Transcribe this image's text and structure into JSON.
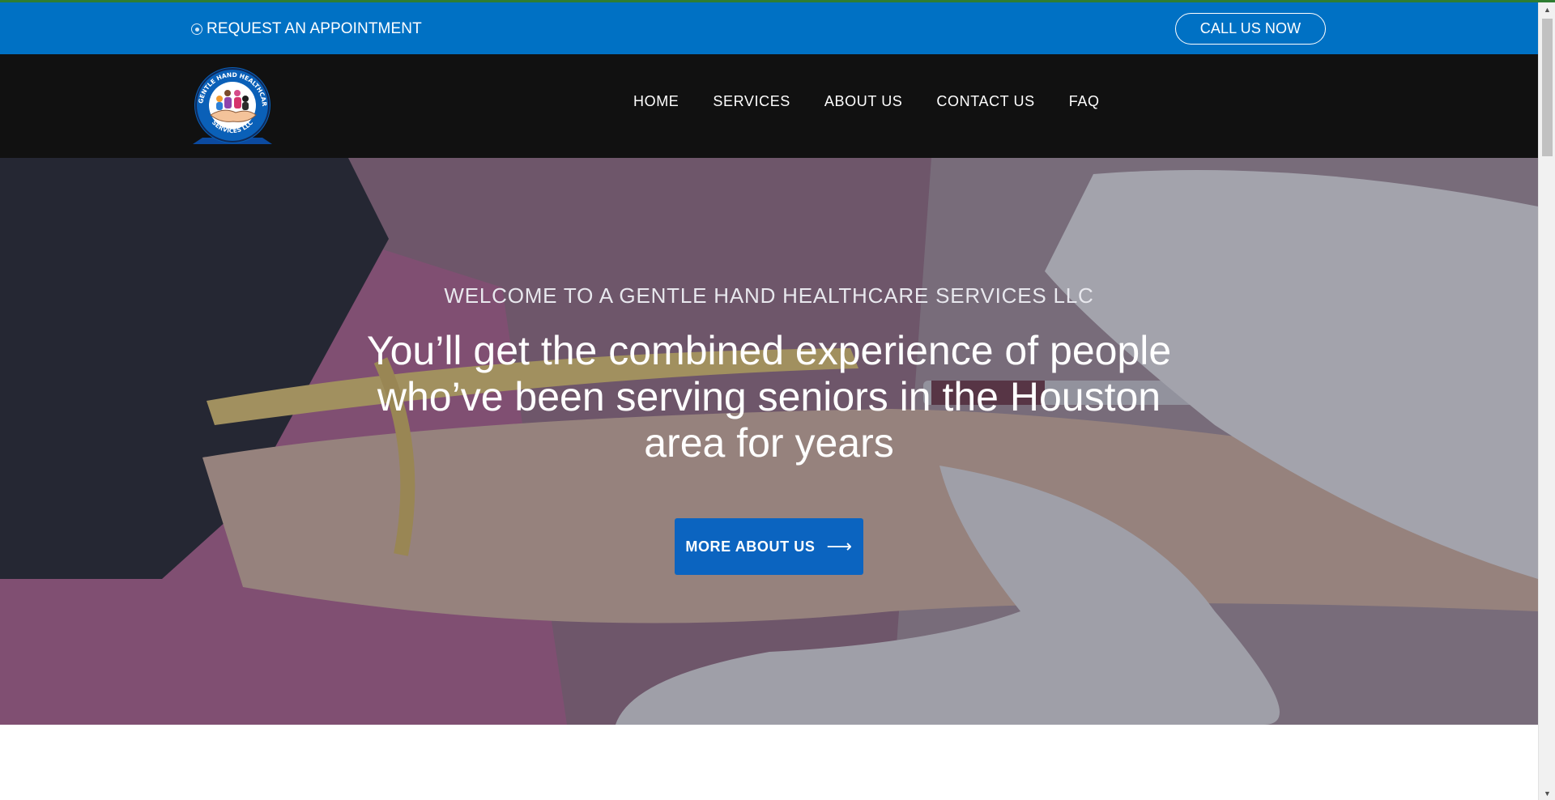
{
  "topbar": {
    "appointment_label": "REQUEST AN APPOINTMENT",
    "call_label": "CALL US NOW",
    "bg_color": "#0071c4"
  },
  "logo": {
    "top_text": "A GENTLE HAND HEALTHCARE",
    "bottom_text": "SERVICES LLC"
  },
  "nav": {
    "items": [
      {
        "label": "HOME"
      },
      {
        "label": "SERVICES"
      },
      {
        "label": "ABOUT US"
      },
      {
        "label": "CONTACT US"
      },
      {
        "label": "FAQ"
      }
    ]
  },
  "hero": {
    "eyebrow": "WELCOME TO A GENTLE HAND HEALTHCARE SERVICES LLC",
    "headline": "You’ll get the combined experience of people who’ve been serving seniors in the Houston area for years",
    "cta_label": "MORE ABOUT US",
    "cta_color": "#0b64c0"
  },
  "icons": {
    "appointment": "radio-circle-icon",
    "cta": "arrow-right-icon",
    "scroll_up": "triangle-up-icon",
    "scroll_down": "triangle-down-icon"
  }
}
